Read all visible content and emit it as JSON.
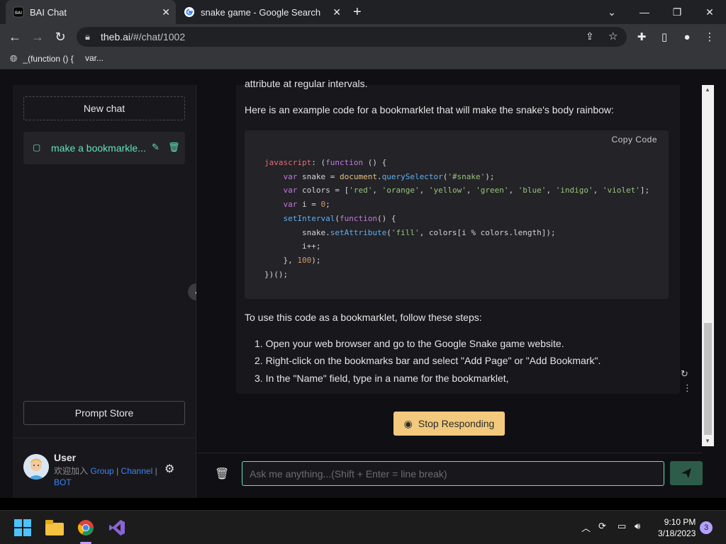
{
  "browser": {
    "tabs": [
      {
        "title": "BAI Chat",
        "active": true
      },
      {
        "title": "snake game - Google Search",
        "active": false
      }
    ],
    "url_host": "theb.ai",
    "url_path": "/#/chat/1002",
    "bookmarks": [
      "_(function () {",
      "var..."
    ]
  },
  "sidebar": {
    "new_chat": "New chat",
    "chat_items": [
      {
        "label": "make a bookmarkle..."
      }
    ],
    "prompt_store": "Prompt Store",
    "user": {
      "name": "User",
      "welcome": "欢迎加入",
      "group": "Group",
      "channel": "Channel",
      "sep": "|",
      "bot": "BOT"
    }
  },
  "message": {
    "cut_line": "attribute at regular intervals.",
    "intro": "Here is an example code for a bookmarklet that will make the snake's body rainbow:",
    "copy_code": "Copy  Code",
    "code_lines": [
      "javascript: (function () {",
      "    var snake = document.querySelector('#snake');",
      "    var colors = ['red', 'orange', 'yellow', 'green', 'blue', 'indigo', 'violet'];",
      "    var i = 0;",
      "    setInterval(function() {",
      "        snake.setAttribute('fill', colors[i % colors.length]);",
      "        i++;",
      "    }, 100);",
      "})();"
    ],
    "steps_intro": "To use this code as a bookmarklet, follow these steps:",
    "steps": [
      "1. Open your web browser and go to the Google Snake game website.",
      "2. Right-click on the bookmarks bar and select \"Add Page\" or \"Add Bookmark\".",
      "3. In the \"Name\" field, type in a name for the bookmarklet,"
    ]
  },
  "stop_button": "Stop Responding",
  "input": {
    "placeholder": "Ask me anything...(Shift + Enter = line break)"
  },
  "taskbar": {
    "time": "9:10 PM",
    "date": "3/18/2023",
    "notifications": "3"
  },
  "colors": {
    "accent": "#63e2b7",
    "stop_button": "#f2c97d",
    "send_button": "#2d5c4b"
  }
}
